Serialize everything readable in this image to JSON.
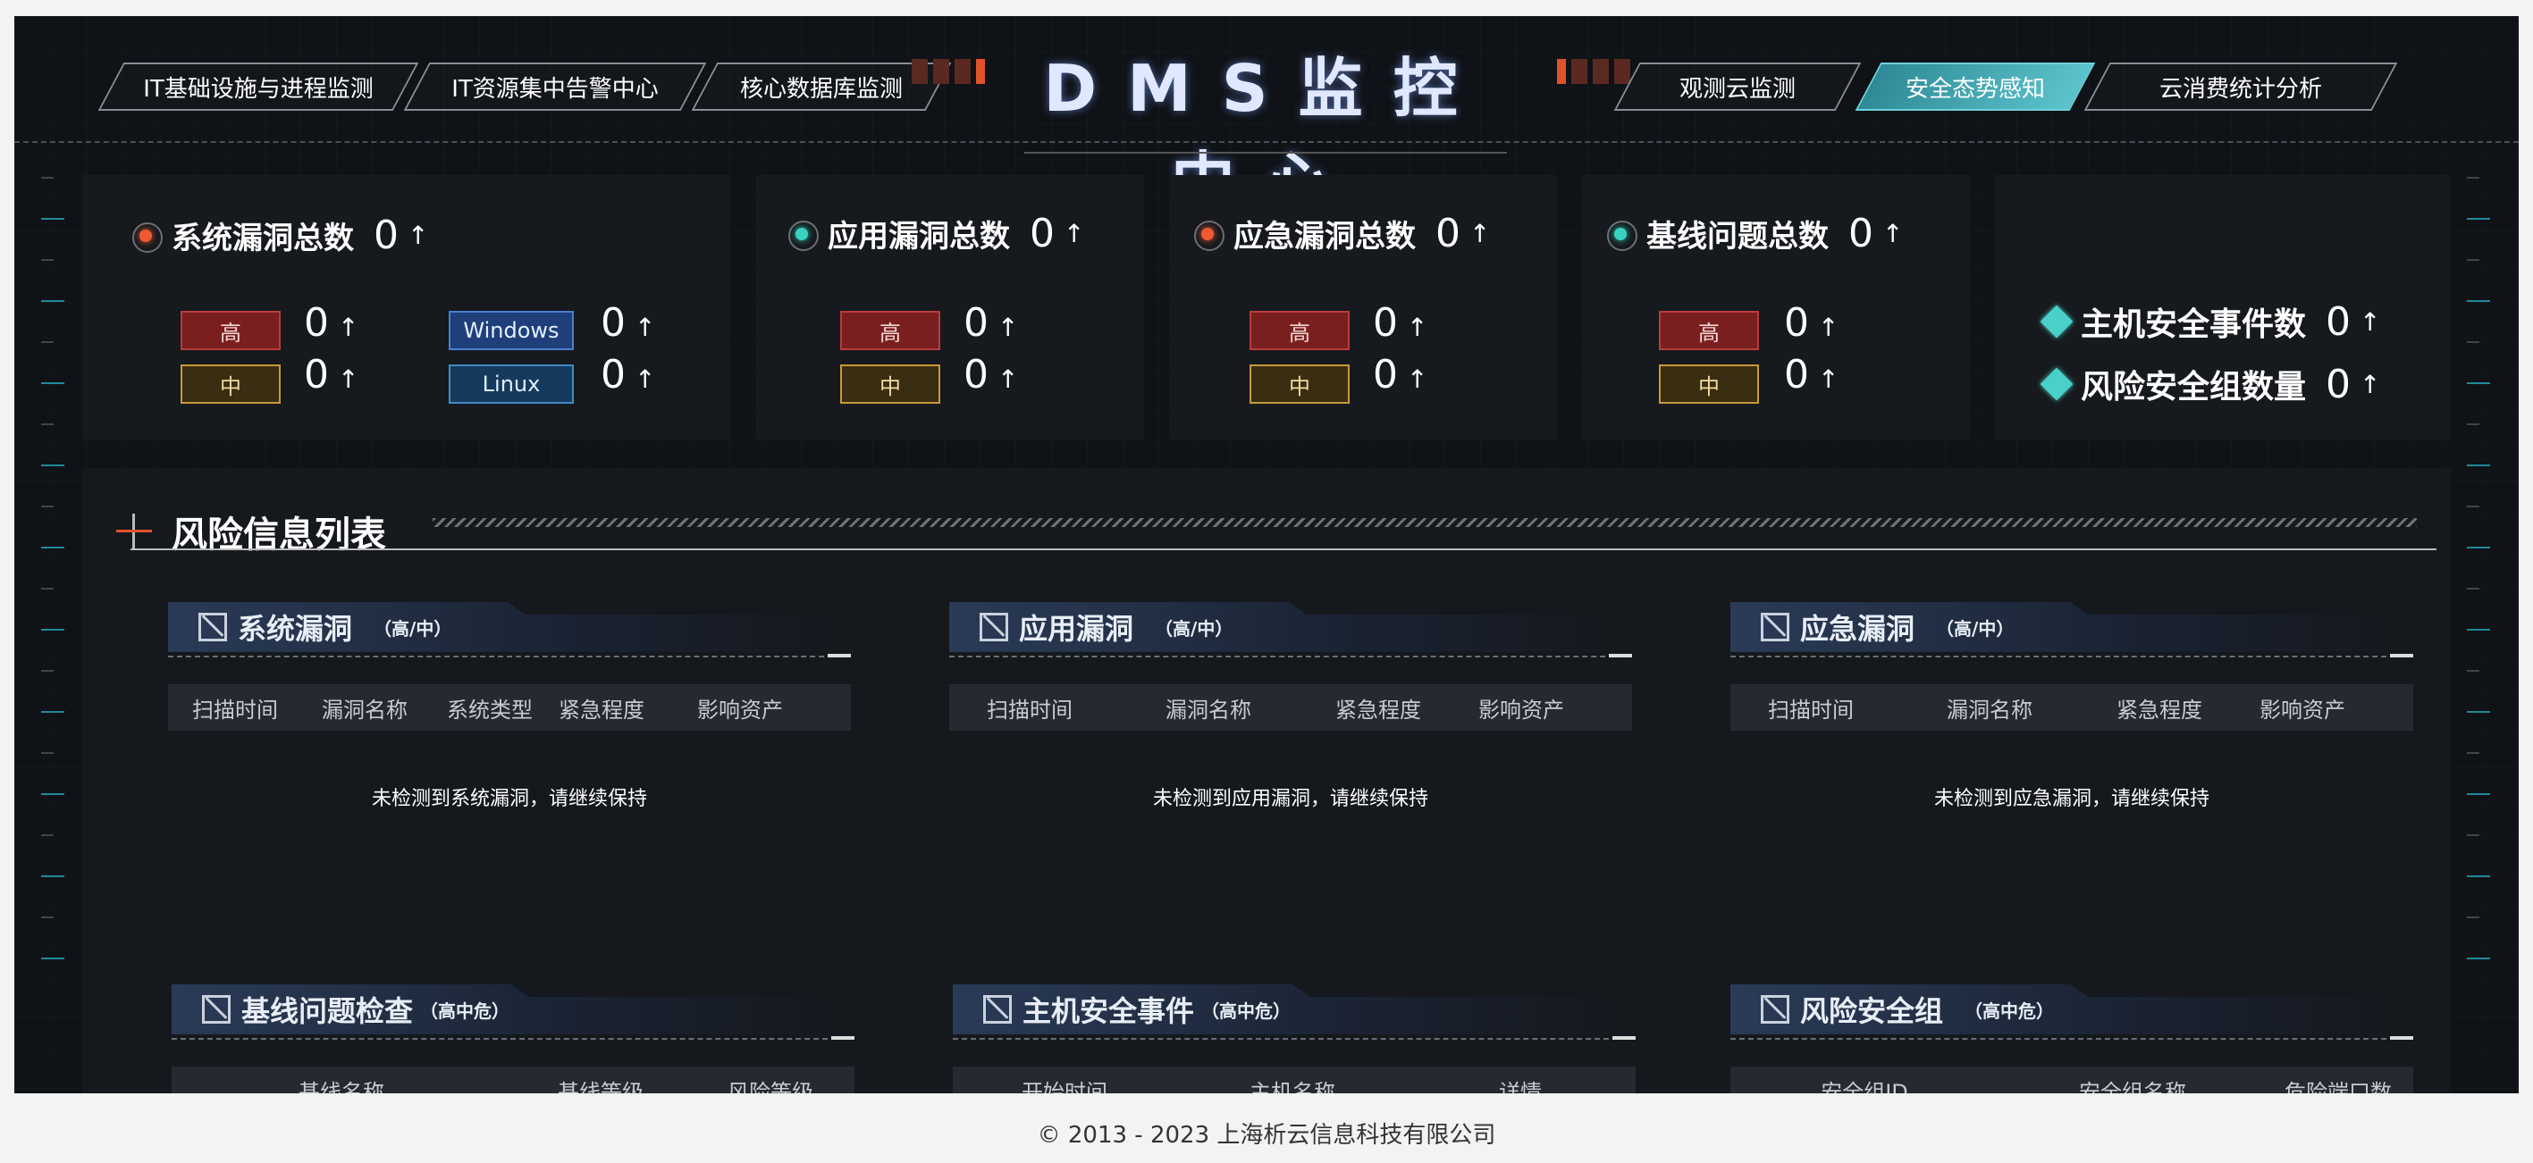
{
  "header": {
    "title": "DMS监控中心",
    "left_tabs": [
      "IT基础设施与进程监测",
      "IT资源集中告警中心",
      "核心数据库监测"
    ],
    "right_tabs": [
      "观测云监测",
      "安全态势感知",
      "云消费统计分析"
    ],
    "active_tab": "安全态势感知",
    "accent_color": "#5cc3cc"
  },
  "stats": {
    "system_vuln": {
      "label": "系统漏洞总数",
      "total": "0",
      "arrow": "↑",
      "high_label": "高",
      "high": "0",
      "mid_label": "中",
      "mid": "0",
      "win_label": "Windows",
      "win": "0",
      "linux_label": "Linux",
      "linux": "0"
    },
    "app_vuln": {
      "label": "应用漏洞总数",
      "total": "0",
      "arrow": "↑",
      "high_label": "高",
      "high": "0",
      "mid_label": "中",
      "mid": "0"
    },
    "emergency_vuln": {
      "label": "应急漏洞总数",
      "total": "0",
      "arrow": "↑",
      "high_label": "高",
      "high": "0",
      "mid_label": "中",
      "mid": "0"
    },
    "baseline": {
      "label": "基线问题总数",
      "total": "0",
      "arrow": "↑",
      "high_label": "高",
      "high": "0",
      "mid_label": "中",
      "mid": "0"
    },
    "host_events": {
      "label": "主机安全事件数",
      "value": "0",
      "arrow": "↑"
    },
    "risk_groups": {
      "label": "风险安全组数量",
      "value": "0",
      "arrow": "↑"
    }
  },
  "risk": {
    "title": "风险信息列表",
    "tables": [
      {
        "name": "系统漏洞",
        "level": "（高/中）",
        "columns": [
          "扫描时间",
          "漏洞名称",
          "系统类型",
          "紧急程度",
          "影响资产"
        ],
        "empty": "未检测到系统漏洞，请继续保持"
      },
      {
        "name": "应用漏洞",
        "level": "（高/中）",
        "columns": [
          "扫描时间",
          "漏洞名称",
          "紧急程度",
          "影响资产"
        ],
        "empty": "未检测到应用漏洞，请继续保持"
      },
      {
        "name": "应急漏洞",
        "level": "（高/中）",
        "columns": [
          "扫描时间",
          "漏洞名称",
          "紧急程度",
          "影响资产"
        ],
        "empty": "未检测到应急漏洞，请继续保持"
      },
      {
        "name": "基线问题检查",
        "level": "（高中危）",
        "columns": [
          "基线名称",
          "基线等级",
          "风险等级"
        ]
      },
      {
        "name": "主机安全事件",
        "level": "（高中危）",
        "columns": [
          "开始时间",
          "主机名称",
          "详情"
        ]
      },
      {
        "name": "风险安全组",
        "level": "（高中危）",
        "columns": [
          "安全组ID",
          "安全组名称",
          "危险端口数"
        ]
      }
    ]
  },
  "footer": "© 2013 - 2023 上海析云信息科技有限公司"
}
